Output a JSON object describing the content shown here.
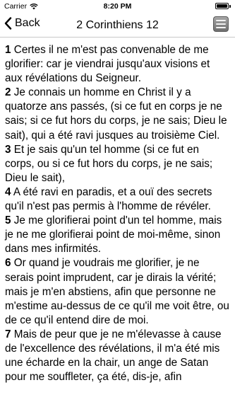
{
  "status_bar": {
    "carrier": "Carrier",
    "time": "8:20 PM"
  },
  "nav": {
    "back_label": "Back",
    "title": "2 Corinthiens 12"
  },
  "verses": [
    {
      "num": "1",
      "text": " Certes il ne m'est pas convenable de me glorifier: car je viendrai jusqu'aux visions et aux révélations du Seigneur."
    },
    {
      "num": "2",
      "text": " Je connais un homme en Christ il y a quatorze ans passés, (si ce fut en corps je ne sais; si ce fut hors du corps, je ne sais; Dieu le sait), qui a été ravi jusques au troisième Ciel."
    },
    {
      "num": "3",
      "text": " Et je sais qu'un tel homme (si ce fut en corps, ou si ce fut hors du corps, je ne sais; Dieu le sait),"
    },
    {
      "num": "4",
      "text": " A été ravi en paradis, et a ouï des secrets qu'il n'est pas permis à l'homme de révéler."
    },
    {
      "num": "5",
      "text": " Je me glorifierai point d'un tel homme, mais je ne me glorifierai point de moi-même, sinon dans mes infirmités."
    },
    {
      "num": "6",
      "text": " Or quand je voudrais me glorifier, je ne serais point imprudent, car je dirais la vérité; mais je m'en abstiens, afin que personne ne m'estime au-dessus de ce qu'il me voit être, ou de ce qu'il entend dire de moi."
    },
    {
      "num": "7",
      "text": " Mais de peur que je ne m'élevasse à cause de l'excellence des révélations, il m'a été mis une écharde en la chair, un ange de Satan pour me souffleter, ça été, dis-je, afin"
    }
  ]
}
